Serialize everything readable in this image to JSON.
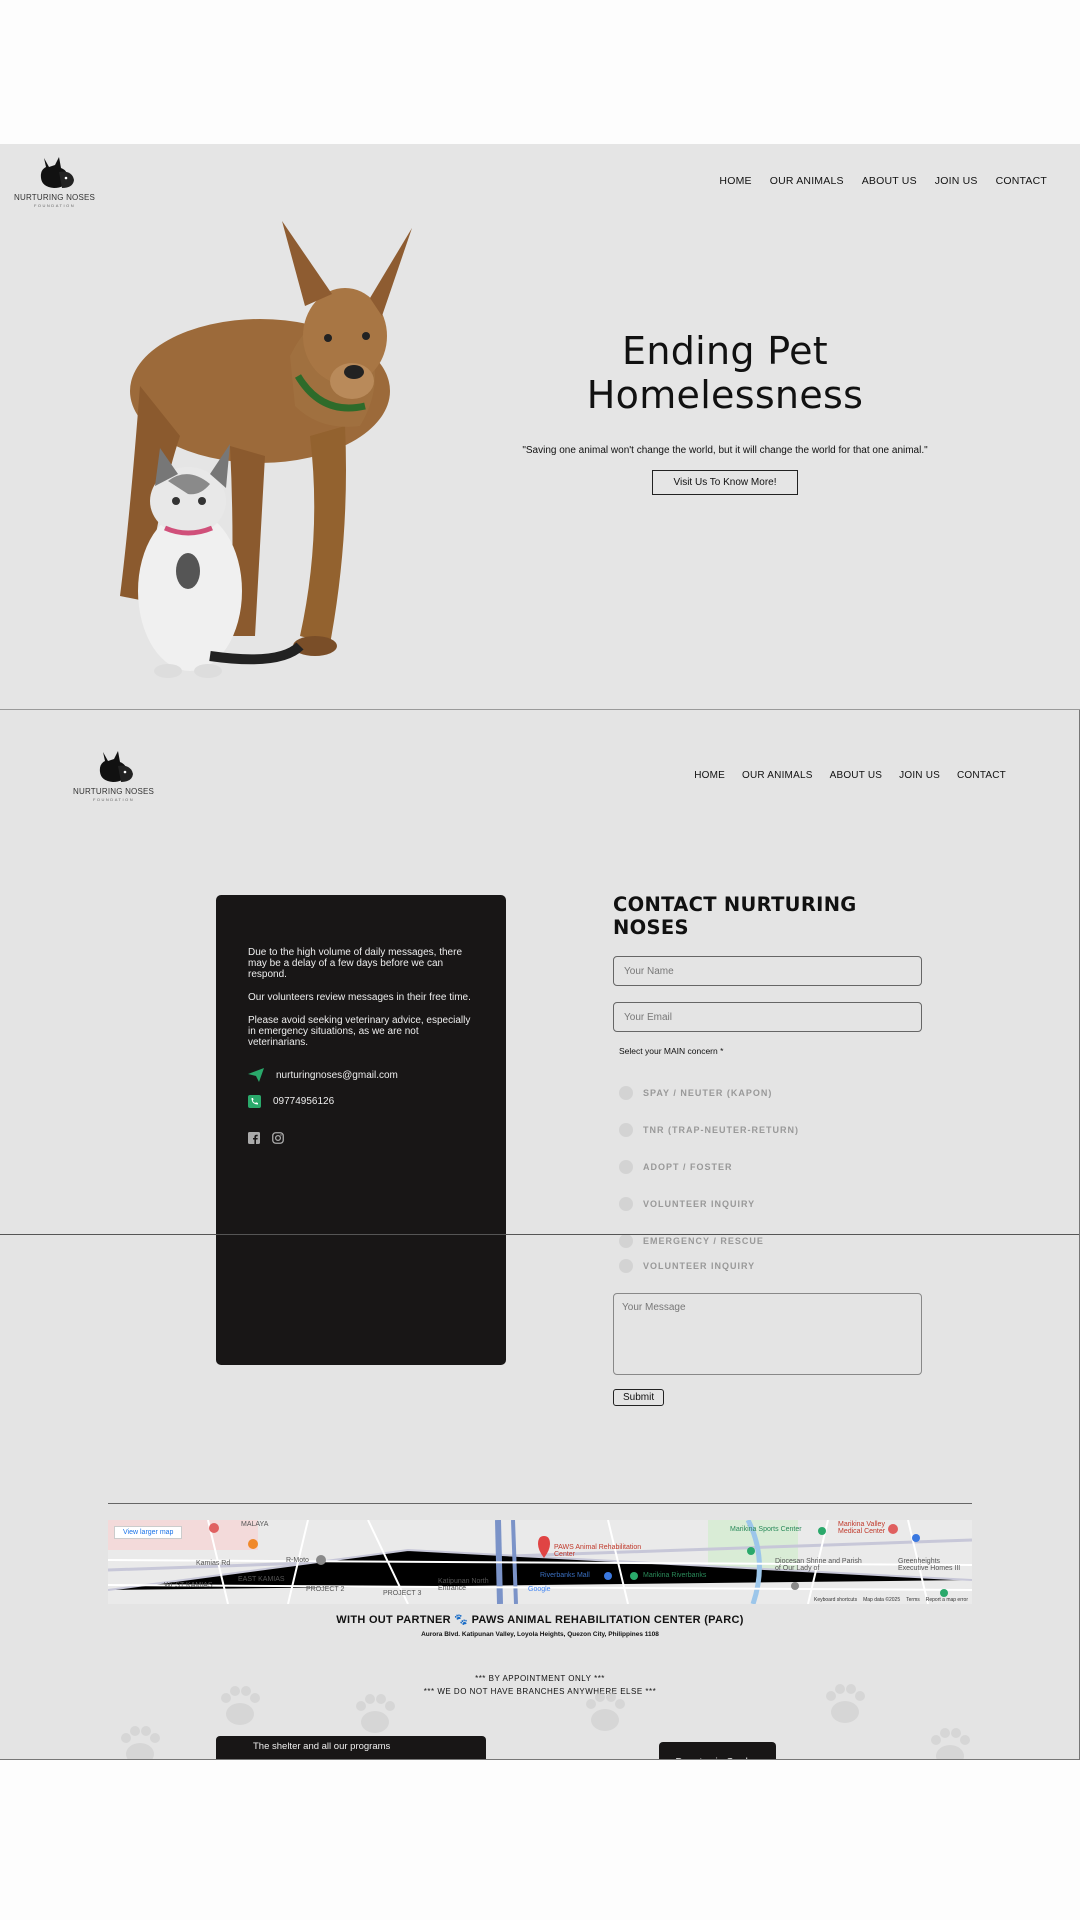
{
  "brand": {
    "name": "NURTURING NOSES",
    "tagline": "FOUNDATION"
  },
  "nav": [
    "HOME",
    "OUR ANIMALS",
    "ABOUT US",
    "JOIN US",
    "CONTACT"
  ],
  "hero": {
    "title": "Ending Pet Homelessness",
    "quote": "\"Saving one animal won't change the world, but it will change the world for that one animal.\"",
    "button": "Visit Us To Know More!"
  },
  "info": {
    "para1": "Due to the high volume of daily messages, there may be a delay of a few days before we can respond.",
    "para2": "Our volunteers review messages in their free time.",
    "para3": "Please avoid seeking veterinary advice, especially in emergency situations, as we are not veterinarians.",
    "email": "nurturingnoses@gmail.com",
    "phone": "09774956126"
  },
  "form": {
    "title": "CONTACT NURTURING NOSES",
    "name_placeholder": "Your Name",
    "email_placeholder": "Your Email",
    "concern_label": "Select your MAIN concern *",
    "options": [
      "SPAY / NEUTER (KAPON)",
      "TNR (TRAP-NEUTER-RETURN)",
      "ADOPT / FOSTER",
      "VOLUNTEER INQUIRY",
      "EMERGENCY / RESCUE",
      "VOLUNTEER INQUIRY"
    ],
    "message_placeholder": "Your Message",
    "submit": "Submit"
  },
  "map": {
    "larger_map": "View larger map",
    "labels": [
      "MALAYA",
      "Kamias Rd",
      "R-Moto",
      "WEST KAMIAS",
      "EAST KAMIAS",
      "PROJECT 2",
      "PROJECT 3",
      "Katipunan North Entrance",
      "PAWS Animal Rehabilitation Center",
      "Riverbanks Mall",
      "Marikina Riverbanks",
      "Marikina Sports Center",
      "Marikina Valley Medical Center",
      "Diocesan Shrine and Parish of Our Lady of",
      "Greenheights Executive Homes III",
      "Google"
    ],
    "footer": [
      "Keyboard shortcuts",
      "Map data ©2025",
      "Terms",
      "Report a map error"
    ]
  },
  "partner": {
    "title": "WITH OUT PARTNER 🐾 PAWS ANIMAL REHABILITATION CENTER (PARC)",
    "address": "Aurora Blvd. Katipunan Valley, Loyola Heights, Quezon City, Philippines 1108",
    "appointment": "*** BY APPOINTMENT ONLY ***",
    "branches": "*** WE DO NOT HAVE BRANCHES ANYWHERE ELSE ***"
  },
  "bottom": {
    "card_text": "The shelter and all our programs",
    "donate": "Donate via Card or"
  },
  "colors": {
    "page": "#e4e4e4",
    "dark_card": "#181616",
    "accent_green": "#2aa96b"
  }
}
